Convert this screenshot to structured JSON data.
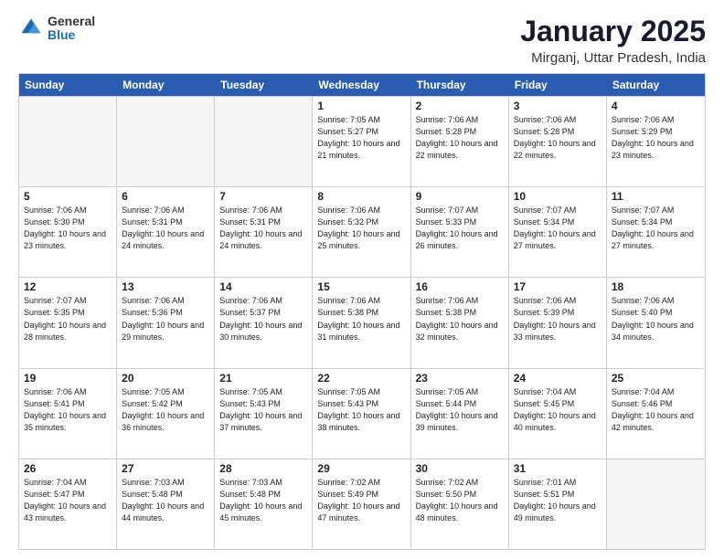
{
  "header": {
    "logo": {
      "general": "General",
      "blue": "Blue"
    },
    "title": "January 2025",
    "location": "Mirganj, Uttar Pradesh, India"
  },
  "weekdays": [
    "Sunday",
    "Monday",
    "Tuesday",
    "Wednesday",
    "Thursday",
    "Friday",
    "Saturday"
  ],
  "weeks": [
    [
      {
        "day": "",
        "empty": true
      },
      {
        "day": "",
        "empty": true
      },
      {
        "day": "",
        "empty": true
      },
      {
        "day": "1",
        "sunrise": "7:05 AM",
        "sunset": "5:27 PM",
        "daylight": "10 hours and 21 minutes."
      },
      {
        "day": "2",
        "sunrise": "7:06 AM",
        "sunset": "5:28 PM",
        "daylight": "10 hours and 22 minutes."
      },
      {
        "day": "3",
        "sunrise": "7:06 AM",
        "sunset": "5:28 PM",
        "daylight": "10 hours and 22 minutes."
      },
      {
        "day": "4",
        "sunrise": "7:06 AM",
        "sunset": "5:29 PM",
        "daylight": "10 hours and 23 minutes."
      }
    ],
    [
      {
        "day": "5",
        "sunrise": "7:06 AM",
        "sunset": "5:30 PM",
        "daylight": "10 hours and 23 minutes."
      },
      {
        "day": "6",
        "sunrise": "7:06 AM",
        "sunset": "5:31 PM",
        "daylight": "10 hours and 24 minutes."
      },
      {
        "day": "7",
        "sunrise": "7:06 AM",
        "sunset": "5:31 PM",
        "daylight": "10 hours and 24 minutes."
      },
      {
        "day": "8",
        "sunrise": "7:06 AM",
        "sunset": "5:32 PM",
        "daylight": "10 hours and 25 minutes."
      },
      {
        "day": "9",
        "sunrise": "7:07 AM",
        "sunset": "5:33 PM",
        "daylight": "10 hours and 26 minutes."
      },
      {
        "day": "10",
        "sunrise": "7:07 AM",
        "sunset": "5:34 PM",
        "daylight": "10 hours and 27 minutes."
      },
      {
        "day": "11",
        "sunrise": "7:07 AM",
        "sunset": "5:34 PM",
        "daylight": "10 hours and 27 minutes."
      }
    ],
    [
      {
        "day": "12",
        "sunrise": "7:07 AM",
        "sunset": "5:35 PM",
        "daylight": "10 hours and 28 minutes."
      },
      {
        "day": "13",
        "sunrise": "7:06 AM",
        "sunset": "5:36 PM",
        "daylight": "10 hours and 29 minutes."
      },
      {
        "day": "14",
        "sunrise": "7:06 AM",
        "sunset": "5:37 PM",
        "daylight": "10 hours and 30 minutes."
      },
      {
        "day": "15",
        "sunrise": "7:06 AM",
        "sunset": "5:38 PM",
        "daylight": "10 hours and 31 minutes."
      },
      {
        "day": "16",
        "sunrise": "7:06 AM",
        "sunset": "5:38 PM",
        "daylight": "10 hours and 32 minutes."
      },
      {
        "day": "17",
        "sunrise": "7:06 AM",
        "sunset": "5:39 PM",
        "daylight": "10 hours and 33 minutes."
      },
      {
        "day": "18",
        "sunrise": "7:06 AM",
        "sunset": "5:40 PM",
        "daylight": "10 hours and 34 minutes."
      }
    ],
    [
      {
        "day": "19",
        "sunrise": "7:06 AM",
        "sunset": "5:41 PM",
        "daylight": "10 hours and 35 minutes."
      },
      {
        "day": "20",
        "sunrise": "7:05 AM",
        "sunset": "5:42 PM",
        "daylight": "10 hours and 36 minutes."
      },
      {
        "day": "21",
        "sunrise": "7:05 AM",
        "sunset": "5:43 PM",
        "daylight": "10 hours and 37 minutes."
      },
      {
        "day": "22",
        "sunrise": "7:05 AM",
        "sunset": "5:43 PM",
        "daylight": "10 hours and 38 minutes."
      },
      {
        "day": "23",
        "sunrise": "7:05 AM",
        "sunset": "5:44 PM",
        "daylight": "10 hours and 39 minutes."
      },
      {
        "day": "24",
        "sunrise": "7:04 AM",
        "sunset": "5:45 PM",
        "daylight": "10 hours and 40 minutes."
      },
      {
        "day": "25",
        "sunrise": "7:04 AM",
        "sunset": "5:46 PM",
        "daylight": "10 hours and 42 minutes."
      }
    ],
    [
      {
        "day": "26",
        "sunrise": "7:04 AM",
        "sunset": "5:47 PM",
        "daylight": "10 hours and 43 minutes."
      },
      {
        "day": "27",
        "sunrise": "7:03 AM",
        "sunset": "5:48 PM",
        "daylight": "10 hours and 44 minutes."
      },
      {
        "day": "28",
        "sunrise": "7:03 AM",
        "sunset": "5:48 PM",
        "daylight": "10 hours and 45 minutes."
      },
      {
        "day": "29",
        "sunrise": "7:02 AM",
        "sunset": "5:49 PM",
        "daylight": "10 hours and 47 minutes."
      },
      {
        "day": "30",
        "sunrise": "7:02 AM",
        "sunset": "5:50 PM",
        "daylight": "10 hours and 48 minutes."
      },
      {
        "day": "31",
        "sunrise": "7:01 AM",
        "sunset": "5:51 PM",
        "daylight": "10 hours and 49 minutes."
      },
      {
        "day": "",
        "empty": true
      }
    ]
  ]
}
